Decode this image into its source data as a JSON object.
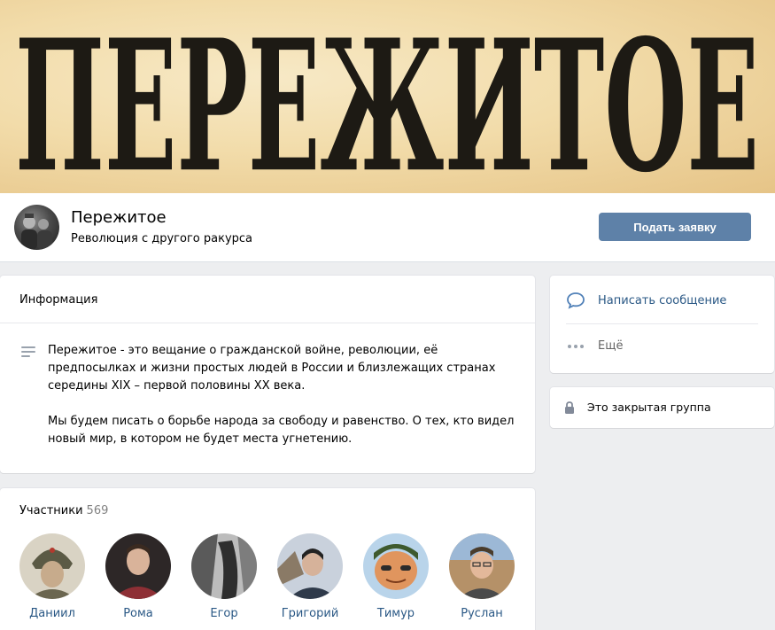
{
  "cover": {
    "title": "ПЕРЕЖИТОЕ"
  },
  "header": {
    "name": "Пережитое",
    "status": "Революция с другого ракурса",
    "join_label": "Подать заявку"
  },
  "info": {
    "title": "Информация",
    "paragraphs": [
      "Пережитое - это вещание о гражданской войне, революции, её предпосылках и жизни простых людей в России и близлежащих странах середины XIX – первой половины XX века.",
      "Мы будем писать о борьбе народа за свободу и равенство. О тех, кто видел новый мир, в котором не будет места угнетению."
    ]
  },
  "members": {
    "title": "Участники",
    "count": "569",
    "people": [
      {
        "name": "Даниил"
      },
      {
        "name": "Рома"
      },
      {
        "name": "Егор"
      },
      {
        "name": "Григорий"
      },
      {
        "name": "Тимур"
      },
      {
        "name": "Руслан"
      }
    ]
  },
  "actions": {
    "write_message": "Написать сообщение",
    "more": "Ещё"
  },
  "closed_group": {
    "label": "Это закрытая группа"
  },
  "colors": {
    "accent": "#5e81a8",
    "link": "#2a5885",
    "background": "#edeef0"
  },
  "icons": {
    "message": "chat-bubble-icon",
    "more": "dots-icon",
    "lock": "lock-icon",
    "description": "lines-icon"
  }
}
